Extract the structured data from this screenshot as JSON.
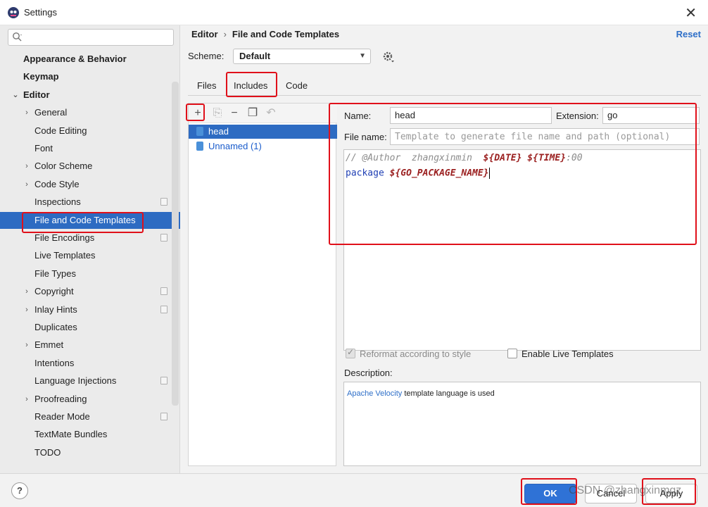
{
  "window": {
    "title": "Settings",
    "close_label": "✕"
  },
  "search": {
    "placeholder": ""
  },
  "sidebar": {
    "items": [
      {
        "label": "Appearance & Behavior",
        "level": 0,
        "bold": true,
        "arrow": ""
      },
      {
        "label": "Keymap",
        "level": 0,
        "bold": true,
        "arrow": ""
      },
      {
        "label": "Editor",
        "level": 0,
        "bold": true,
        "arrow": "⌄"
      },
      {
        "label": "General",
        "level": 1,
        "arrow": "›"
      },
      {
        "label": "Code Editing",
        "level": 1,
        "arrow": ""
      },
      {
        "label": "Font",
        "level": 1,
        "arrow": ""
      },
      {
        "label": "Color Scheme",
        "level": 1,
        "arrow": "›"
      },
      {
        "label": "Code Style",
        "level": 1,
        "arrow": "›"
      },
      {
        "label": "Inspections",
        "level": 1,
        "arrow": "",
        "badge": true
      },
      {
        "label": "File and Code Templates",
        "level": 1,
        "arrow": "",
        "selected": true
      },
      {
        "label": "File Encodings",
        "level": 1,
        "arrow": "",
        "badge": true
      },
      {
        "label": "Live Templates",
        "level": 1,
        "arrow": ""
      },
      {
        "label": "File Types",
        "level": 1,
        "arrow": ""
      },
      {
        "label": "Copyright",
        "level": 1,
        "arrow": "›",
        "badge": true
      },
      {
        "label": "Inlay Hints",
        "level": 1,
        "arrow": "›",
        "badge": true
      },
      {
        "label": "Duplicates",
        "level": 1,
        "arrow": ""
      },
      {
        "label": "Emmet",
        "level": 1,
        "arrow": "›"
      },
      {
        "label": "Intentions",
        "level": 1,
        "arrow": ""
      },
      {
        "label": "Language Injections",
        "level": 1,
        "arrow": "",
        "badge": true
      },
      {
        "label": "Proofreading",
        "level": 1,
        "arrow": "›"
      },
      {
        "label": "Reader Mode",
        "level": 1,
        "arrow": "",
        "badge": true
      },
      {
        "label": "TextMate Bundles",
        "level": 1,
        "arrow": ""
      },
      {
        "label": "TODO",
        "level": 1,
        "arrow": ""
      }
    ]
  },
  "breadcrumb": {
    "parent": "Editor",
    "separator": "›",
    "current": "File and Code Templates"
  },
  "reset_label": "Reset",
  "scheme": {
    "label": "Scheme:",
    "value": "Default"
  },
  "tabs": [
    {
      "label": "Files"
    },
    {
      "label": "Includes",
      "active": true
    },
    {
      "label": "Code"
    }
  ],
  "toolbar": {
    "add": "+",
    "copy": "⎘",
    "remove": "−",
    "duplicate": "❐",
    "reset": "↶"
  },
  "templates": [
    {
      "label": "head",
      "selected": true
    },
    {
      "label": "Unnamed (1)",
      "link": true
    }
  ],
  "form": {
    "name_label": "Name:",
    "name_value": "head",
    "extension_label": "Extension:",
    "extension_value": "go",
    "filename_label": "File name:",
    "filename_placeholder": "Template to generate file name and path (optional)"
  },
  "code": {
    "line1_comment": "// @Author  zhangxinmin  ",
    "line1_var1": "${DATE}",
    "line1_space": " ",
    "line1_var2": "${TIME}",
    "line1_tail": ":00",
    "line2_kw": "package ",
    "line2_var": "${GO_PACKAGE_NAME}"
  },
  "options": {
    "reformat_label": "Reformat according to style",
    "live_label": "Enable Live Templates"
  },
  "description": {
    "label": "Description:",
    "link_text": "Apache Velocity",
    "text": " template language is used"
  },
  "footer": {
    "help": "?",
    "ok": "OK",
    "cancel": "Cancel",
    "apply": "Apply"
  },
  "watermark": "CSDN @zhangxinmqz",
  "colors": {
    "accent": "#2f72d6",
    "selection": "#2d6bc2",
    "highlight": "#e0101a"
  }
}
